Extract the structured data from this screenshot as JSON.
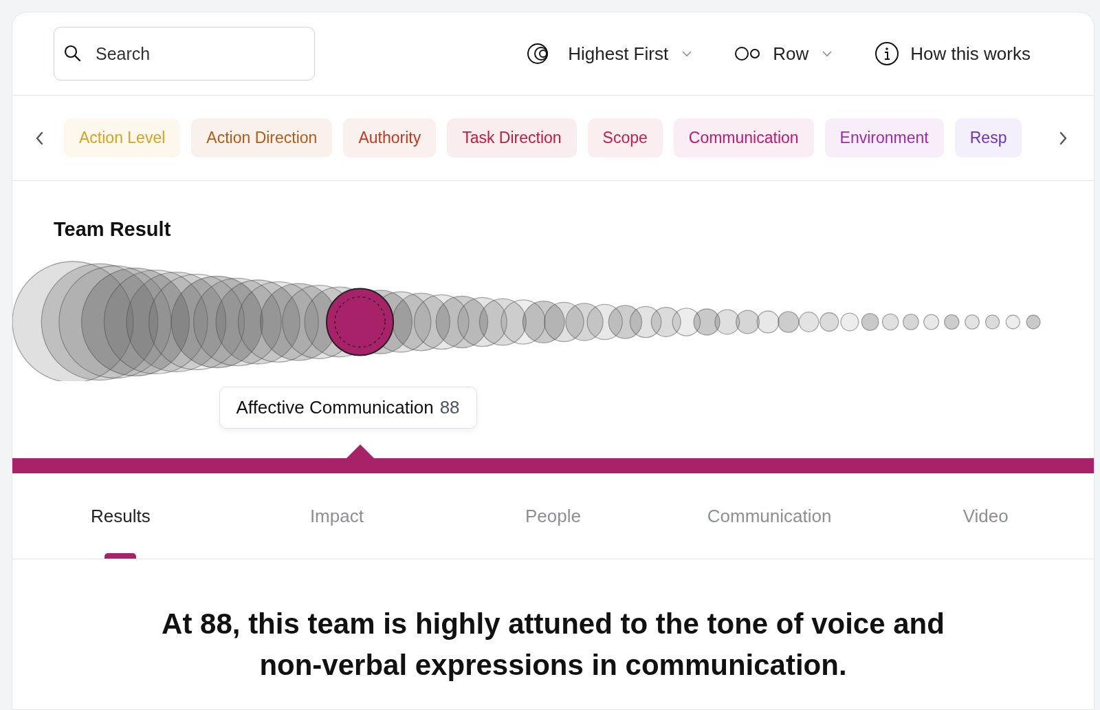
{
  "toolbar": {
    "search": {
      "placeholder": "Search"
    },
    "sort": {
      "label": "Highest First"
    },
    "view": {
      "label": "Row"
    },
    "help": {
      "label": "How this works"
    }
  },
  "categories": [
    {
      "label": "Action Level",
      "color": "#d9a21b"
    },
    {
      "label": "Action Direction",
      "color": "#b45a12"
    },
    {
      "label": "Authority",
      "color": "#c23a1c"
    },
    {
      "label": "Task Direction",
      "color": "#be1e3c"
    },
    {
      "label": "Scope",
      "color": "#c0204a"
    },
    {
      "label": "Communication",
      "color": "#c0186e"
    },
    {
      "label": "Environment",
      "color": "#a326b0"
    },
    {
      "label": "Resp",
      "color": "#6a32c8"
    }
  ],
  "section": {
    "title": "Team Result",
    "tooltip": {
      "name": "Affective Communication",
      "score": "88"
    }
  },
  "tabs": [
    {
      "label": "Results",
      "selected": true
    },
    {
      "label": "Impact",
      "selected": false
    },
    {
      "label": "People",
      "selected": false
    },
    {
      "label": "Communication",
      "selected": false
    },
    {
      "label": "Video",
      "selected": false
    }
  ],
  "summary": "At 88, this team is highly attuned to the tone of voice and non-verbal expressions in communication."
}
